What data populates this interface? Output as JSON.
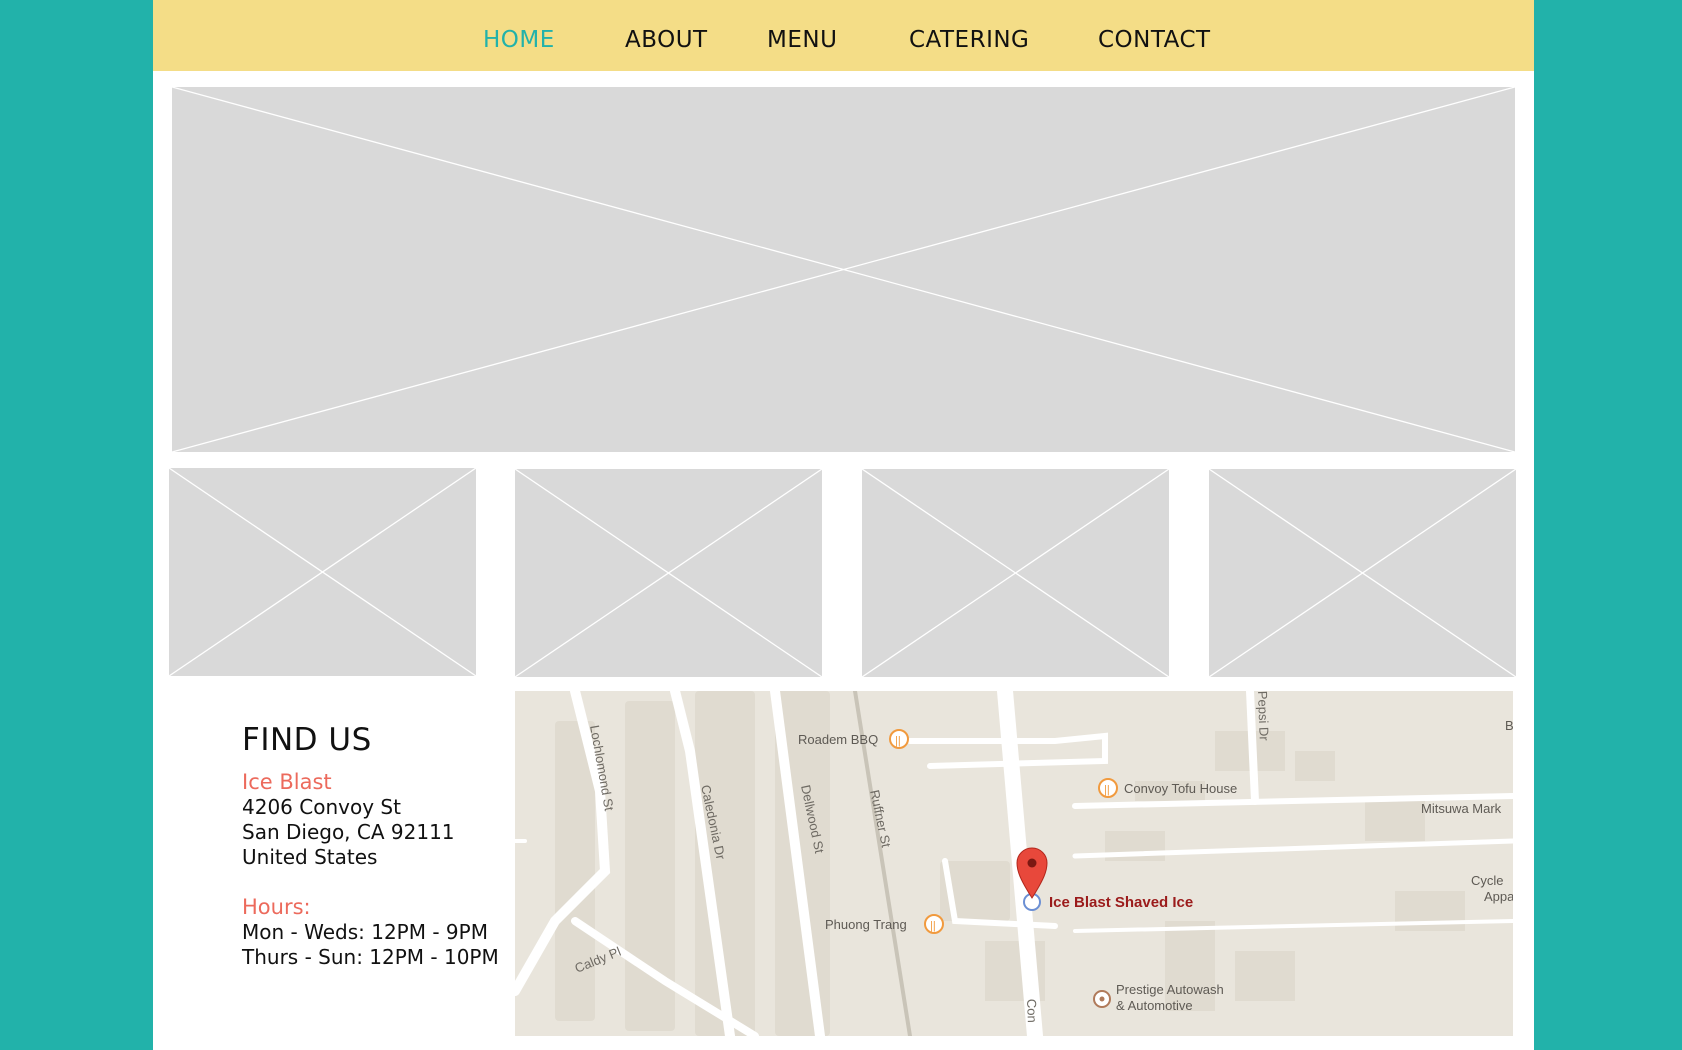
{
  "nav": {
    "items": [
      {
        "label": "HOME",
        "active": true
      },
      {
        "label": "ABOUT",
        "active": false
      },
      {
        "label": "MENU",
        "active": false
      },
      {
        "label": "CATERING",
        "active": false
      },
      {
        "label": "CONTACT",
        "active": false
      }
    ]
  },
  "find_us": {
    "heading": "FIND US",
    "name": "Ice Blast",
    "address_lines": [
      "4206 Convoy St",
      "San Diego, CA 92111",
      "United States"
    ],
    "hours_label": "Hours:",
    "hours_lines": [
      "Mon - Weds: 12PM - 9PM",
      "Thurs - Sun: 12PM - 10PM"
    ]
  },
  "map": {
    "streets": [
      "Lochlomond St",
      "Caledonia Dr",
      "Dellwood St",
      "Ruffner St",
      "Caldy Pl",
      "Pepsi Dr",
      "Con"
    ],
    "places": [
      "Roadem BBQ",
      "Convoy Tofu House",
      "Mitsuwa Mark",
      "Ice Blast Shaved Ice",
      "Phuong Trang",
      "Cycle",
      "Appa",
      "Prestige Autowash",
      "& Automotive",
      "B"
    ]
  },
  "colors": {
    "background": "#22b2aa",
    "nav_bg": "#f4dd87",
    "accent": "#22b2aa",
    "label": "#ec6a5c",
    "placeholder": "#d9d9d9"
  }
}
